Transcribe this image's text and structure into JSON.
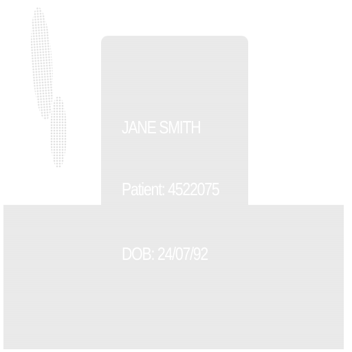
{
  "label": {
    "name": "JANE SMITH",
    "patient": "Patient: 4522075",
    "dob": "DOB: 24/07/92"
  },
  "colors": {
    "background": "#ffffff",
    "panel": "#e9e9e9",
    "text": "#ffffff"
  }
}
